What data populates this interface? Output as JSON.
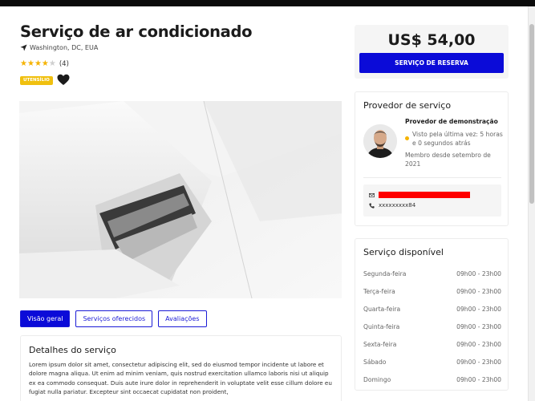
{
  "service": {
    "title": "Serviço de ar condicionado",
    "location": "Washington, DC, EUA",
    "rating": 4,
    "rating_max": 5,
    "review_count": "(4)",
    "category_badge": "UTENSÍLIO",
    "heart_icon": "heart-icon",
    "location_icon": "location-arrow-icon"
  },
  "tabs": [
    {
      "label": "Visão geral",
      "active": true
    },
    {
      "label": "Serviços oferecidos",
      "active": false
    },
    {
      "label": "Avaliações",
      "active": false
    }
  ],
  "details": {
    "heading": "Detalhes do serviço",
    "body": "Lorem ipsum dolor sit amet, consectetur adipiscing elit, sed do eiusmod tempor incidente ut labore et dolore magna aliqua. Ut enim ad minim veniam, quis nostrud exercitation ullamco laboris nisi ut aliquip ex ea commodo consequat. Duis aute irure dolor in reprehenderit in voluptate velit esse cillum dolore eu fugiat nulla pariatur. Excepteur sint occaecat cupidatat non proident,"
  },
  "booking": {
    "price": "US$ 54,00",
    "button_label": "SERVIÇO DE RESERVA"
  },
  "provider": {
    "section_title": "Provedor de serviço",
    "name": "Provedor de demonstração",
    "last_seen": "Visto pela última vez: 5 horas e 0 segundos atrás",
    "member_since": "Membro desde setembro de 2021",
    "phone": "xxxxxxxxx84",
    "email_redacted": true,
    "online_status_color": "#f5b301"
  },
  "availability": {
    "section_title": "Serviço disponível",
    "days": [
      {
        "day": "Segunda-feira",
        "hours": "09h00 - 23h00"
      },
      {
        "day": "Terça-feira",
        "hours": "09h00 - 23h00"
      },
      {
        "day": "Quarta-feira",
        "hours": "09h00 - 23h00"
      },
      {
        "day": "Quinta-feira",
        "hours": "09h00 - 23h00"
      },
      {
        "day": "Sexta-feira",
        "hours": "09h00 - 23h00"
      },
      {
        "day": "Sábado",
        "hours": "09h00 - 23h00"
      },
      {
        "day": "Domingo",
        "hours": "09h00 - 23h00"
      }
    ]
  },
  "colors": {
    "primary": "#0b0bd8",
    "badge": "#f0c00f",
    "star": "#f5b301",
    "redaction": "#ff0000"
  }
}
